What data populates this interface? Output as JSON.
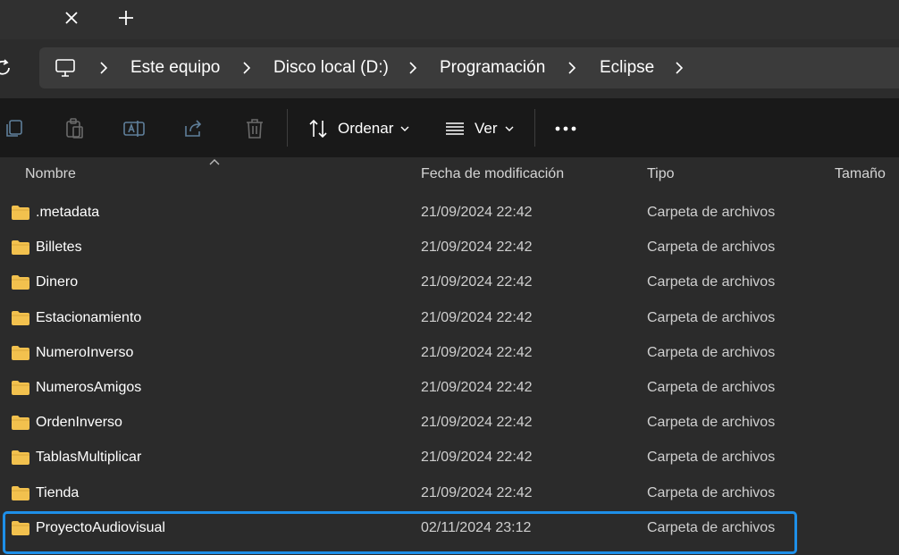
{
  "colors": {
    "background": "#2b2b2b",
    "command_bar": "#191919",
    "address_bar": "#3b3b3b",
    "folder": "#f2c14e",
    "selection_border": "#1e8fe8"
  },
  "tabstrip": {
    "close_icon": "close-icon",
    "new_tab_icon": "plus-icon"
  },
  "address": {
    "crumbs": [
      "Este equipo",
      "Disco local (D:)",
      "Programación",
      "Eclipse"
    ]
  },
  "toolbar": {
    "sort_label": "Ordenar",
    "view_label": "Ver",
    "more_icon": "more-icon"
  },
  "columns": {
    "name": "Nombre",
    "date": "Fecha de modificación",
    "type": "Tipo",
    "size": "Tamaño"
  },
  "files": [
    {
      "name": ".metadata",
      "date": "21/09/2024 22:42",
      "type": "Carpeta de archivos"
    },
    {
      "name": "Billetes",
      "date": "21/09/2024 22:42",
      "type": "Carpeta de archivos"
    },
    {
      "name": "Dinero",
      "date": "21/09/2024 22:42",
      "type": "Carpeta de archivos"
    },
    {
      "name": "Estacionamiento",
      "date": "21/09/2024 22:42",
      "type": "Carpeta de archivos"
    },
    {
      "name": "NumeroInverso",
      "date": "21/09/2024 22:42",
      "type": "Carpeta de archivos"
    },
    {
      "name": "NumerosAmigos",
      "date": "21/09/2024 22:42",
      "type": "Carpeta de archivos"
    },
    {
      "name": "OrdenInverso",
      "date": "21/09/2024 22:42",
      "type": "Carpeta de archivos"
    },
    {
      "name": "TablasMultiplicar",
      "date": "21/09/2024 22:42",
      "type": "Carpeta de archivos"
    },
    {
      "name": "Tienda",
      "date": "21/09/2024 22:42",
      "type": "Carpeta de archivos"
    },
    {
      "name": "ProyectoAudiovisual",
      "date": "02/11/2024 23:12",
      "type": "Carpeta de archivos",
      "selected": true
    }
  ]
}
